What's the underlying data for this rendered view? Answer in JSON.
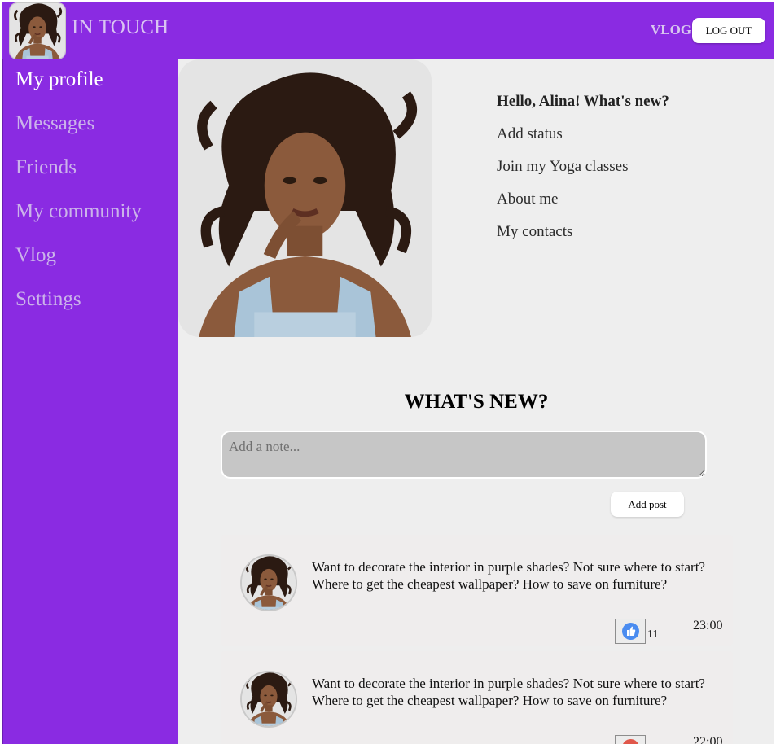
{
  "header": {
    "brand": "IN TOUCH",
    "vlog_link": "VLOG",
    "logout_label": "LOG OUT"
  },
  "sidebar": {
    "items": [
      {
        "label": "My profile",
        "active": true
      },
      {
        "label": "Messages"
      },
      {
        "label": "Friends"
      },
      {
        "label": "My community"
      },
      {
        "label": "Vlog"
      },
      {
        "label": "Settings"
      }
    ]
  },
  "profile": {
    "greeting": "Hello, Alina! What's new?",
    "links": [
      "Add status",
      "Join my Yoga classes",
      "About me",
      "My contacts"
    ]
  },
  "feed": {
    "heading": "WHAT'S NEW?",
    "note_placeholder": "Add a note...",
    "add_post_label": "Add post",
    "posts": [
      {
        "text": "Want to decorate the interior in purple shades? Not sure where to start?Where to get the cheapest wallpaper? How to save on furniture?",
        "reaction_icon": "thumbs-up-icon",
        "reaction_color": "#4a8cf0",
        "likes": "11",
        "time": "23:00"
      },
      {
        "text": "Want to decorate the interior in purple shades? Not sure where to start?Where to get the cheapest wallpaper? How to save on furniture?",
        "reaction_icon": "heart-icon",
        "reaction_color": "#e0574a",
        "likes": "",
        "time": "22:00"
      }
    ]
  },
  "colors": {
    "brand_purple": "#8a2be2",
    "page_bg": "#eeeeee"
  }
}
